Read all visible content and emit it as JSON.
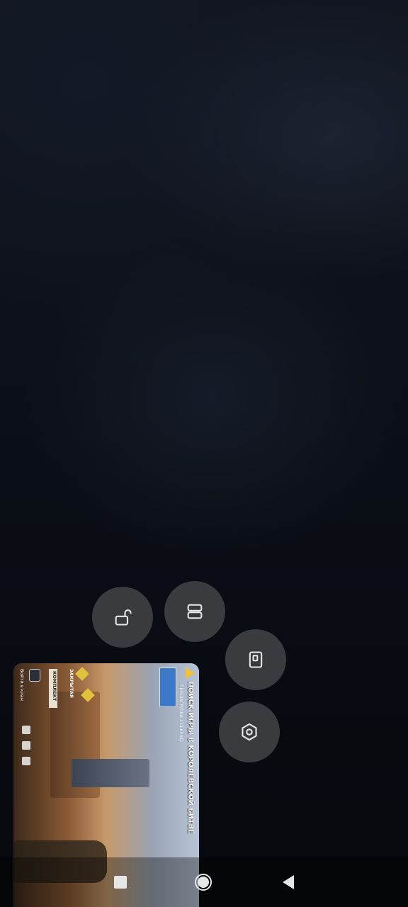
{
  "floating_controls": {
    "lock": {
      "icon": "unlock-icon"
    },
    "split": {
      "icon": "split-screen-icon"
    },
    "window": {
      "icon": "window-icon"
    },
    "settings": {
      "icon": "settings-icon"
    }
  },
  "game_preview": {
    "banner_text": "ПОИСК ИГРЫ В КОРОЛЕВСКОЙ БИТВЕ",
    "timer_text": "ПЕРЕЗАГРУЗКА 3 СЕКУНД",
    "category_a": "ЗАКРЫТАЯ",
    "category_b": "КОМПЛЕКТ",
    "bottom_label": "Войти в клан"
  },
  "navigation_bar": {
    "recents": "recents-square-icon",
    "home": "home-circle-icon",
    "back": "back-triangle-icon"
  }
}
